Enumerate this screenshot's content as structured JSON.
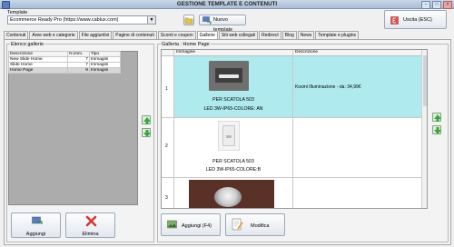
{
  "window": {
    "title": "GESTIONE TEMPLATE E CONTENUTI"
  },
  "template": {
    "label": "Template",
    "selected": "Ecommerce Ready Pro (https://www.cablux.com)",
    "new_button": "Nuovo template",
    "exit_button": "Uscita (ESC)"
  },
  "tabs": [
    "Contenuti",
    "Aree web e categorie",
    "File aggiuntivi",
    "Pagine di contenuti",
    "Sconti e coupon",
    "Gallerie",
    "Siti web collegati",
    "Redirect",
    "Blog",
    "News",
    "Template e plugins"
  ],
  "active_tab_index": 5,
  "gallery_list": {
    "title": "Elenco gallerie",
    "columns": [
      "Descrizione",
      "N.imm.",
      "Tipo"
    ],
    "rows": [
      {
        "desc": "New Slide Home",
        "count": "7",
        "type": "Immagini"
      },
      {
        "desc": "Slide Home",
        "count": "7",
        "type": "Immagini"
      },
      {
        "desc": "Home Page",
        "count": "9",
        "type": "Immagini"
      }
    ],
    "selected_row": 2,
    "add_button": "Aggiungi",
    "delete_button": "Elimina"
  },
  "gallery_detail": {
    "title": "Galleria : Home Page",
    "columns": [
      "Immagine",
      "Descrizione"
    ],
    "rows": [
      {
        "num": "1",
        "caption_line1": "PER SCATOLA 503",
        "caption_line2": "LED 3W-IP65-COLORE: AN",
        "description": "Kosmi Illuminazione - da: 34,99€"
      },
      {
        "num": "2",
        "caption_line1": "PER SCATOLA 503",
        "caption_line2": "LED 3W-IP65-COLORE:B",
        "description": ""
      },
      {
        "num": "3",
        "caption_line1": "",
        "caption_line2": "",
        "description": ""
      }
    ],
    "add_button": "Aggiungi (F4)",
    "edit_button": "Modifica"
  },
  "colors": {
    "selection": "#aeeaee",
    "accent": "#5b7dbb"
  }
}
